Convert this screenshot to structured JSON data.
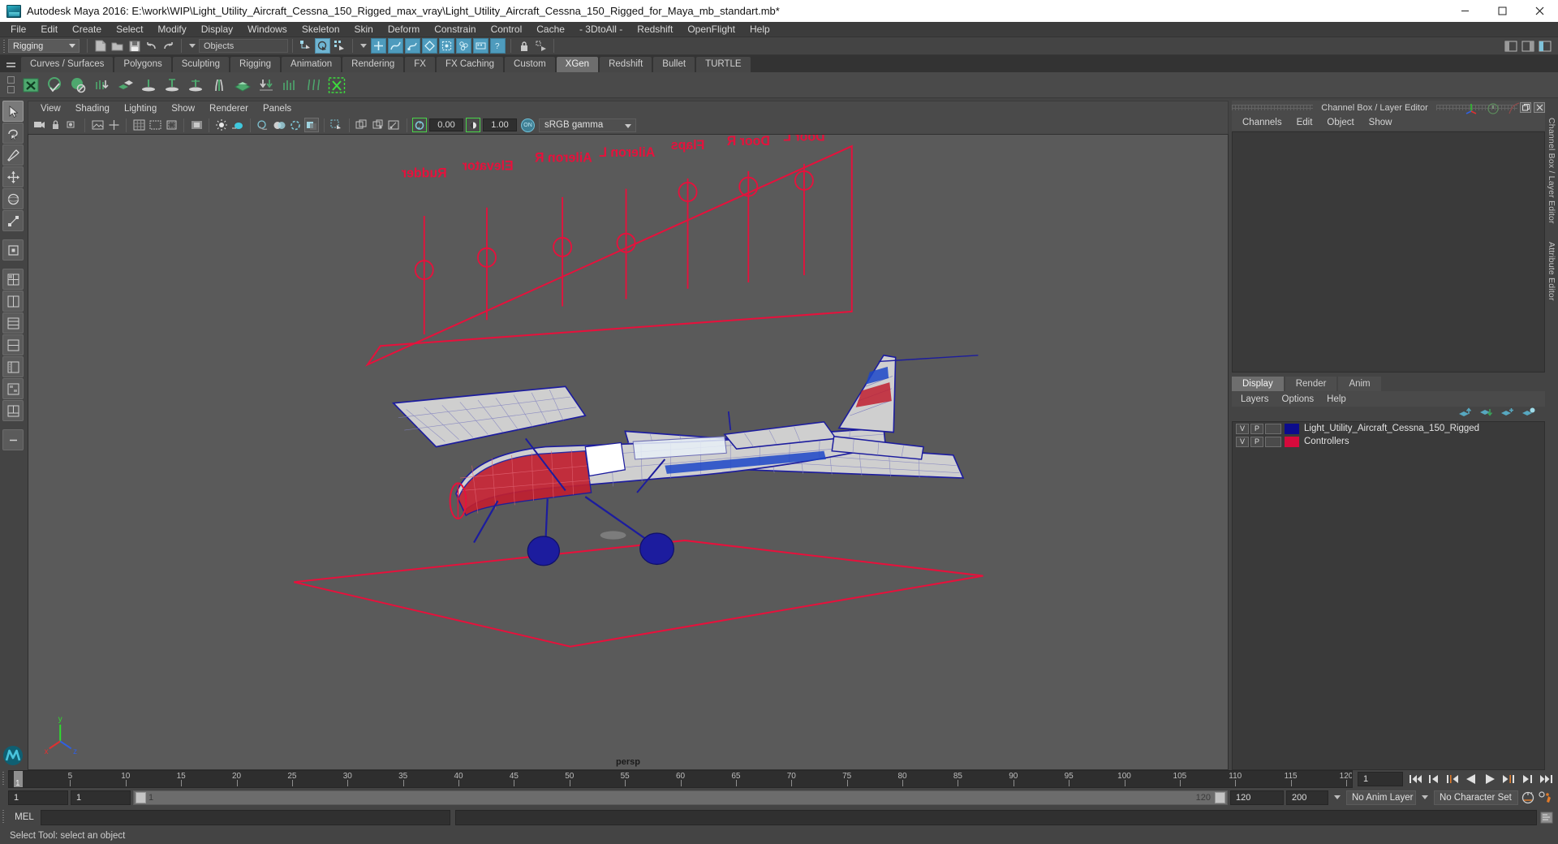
{
  "window": {
    "title": "Autodesk Maya 2016: E:\\work\\WIP\\Light_Utility_Aircraft_Cessna_150_Rigged_max_vray\\Light_Utility_Aircraft_Cessna_150_Rigged_for_Maya_mb_standart.mb*",
    "minimize": "minimize-button",
    "maximize": "maximize-button",
    "close": "close-button"
  },
  "menubar": {
    "items": [
      "File",
      "Edit",
      "Create",
      "Select",
      "Modify",
      "Display",
      "Windows",
      "Skeleton",
      "Skin",
      "Deform",
      "Constrain",
      "Control",
      "Cache",
      "- 3DtoAll -",
      "Redshift",
      "OpenFlight",
      "Help"
    ]
  },
  "statusline": {
    "menu_set": "Rigging",
    "selection_mask": "Objects"
  },
  "shelf": {
    "tabs": [
      "Curves / Surfaces",
      "Polygons",
      "Sculpting",
      "Rigging",
      "Animation",
      "Rendering",
      "FX",
      "FX Caching",
      "Custom",
      "XGen",
      "Redshift",
      "Bullet",
      "TURTLE"
    ],
    "active_tab": "XGen"
  },
  "viewport": {
    "menus": [
      "View",
      "Shading",
      "Lighting",
      "Show",
      "Renderer",
      "Panels"
    ],
    "exposure": "0.00",
    "gamma": "1.00",
    "color_management_toggle": "ON",
    "view_transform": "sRGB gamma",
    "camera_label": "persp",
    "axis": {
      "x": "x",
      "y": "y",
      "z": "z"
    },
    "controller_labels": [
      "Rudder",
      "Elevator",
      "Aileron R",
      "Aileron L",
      "Flaps",
      "Door R",
      "Door L"
    ]
  },
  "right_panel": {
    "title": "Channel Box / Layer Editor",
    "channel_menus": [
      "Channels",
      "Edit",
      "Object",
      "Show"
    ],
    "layer_tabs": [
      "Display",
      "Render",
      "Anim"
    ],
    "active_layer_tab": "Display",
    "layer_menus": [
      "Layers",
      "Options",
      "Help"
    ],
    "layers": [
      {
        "visible": "V",
        "playback": "P",
        "color": "#0c0c8c",
        "name": "Light_Utility_Aircraft_Cessna_150_Rigged"
      },
      {
        "visible": "V",
        "playback": "P",
        "color": "#d60a3c",
        "name": "Controllers"
      }
    ],
    "edge_tabs": [
      "Channel Box / Layer Editor",
      "Attribute Editor"
    ]
  },
  "timeline": {
    "labels": [
      "5",
      "10",
      "15",
      "20",
      "25",
      "30",
      "35",
      "40",
      "45",
      "50",
      "55",
      "60",
      "65",
      "70",
      "75",
      "80",
      "85",
      "90",
      "95",
      "100",
      "105",
      "110",
      "115",
      "120"
    ],
    "current_frame": "1",
    "start_display": "1",
    "range_start": "1",
    "range_min": "1",
    "range_slider_start": "1",
    "range_slider_end": "120",
    "range_end": "120",
    "anim_end": "200",
    "anim_layer": "No Anim Layer",
    "character_set": "No Character Set",
    "playback_buttons": [
      "go-to-start",
      "step-back-key",
      "step-back-frame",
      "play-backwards",
      "play-forwards",
      "step-forward-frame",
      "step-forward-key",
      "go-to-end"
    ]
  },
  "command_line": {
    "label": "MEL",
    "value": "",
    "placeholder": ""
  },
  "status_bar": {
    "message": "Select Tool: select an object"
  },
  "colors": {
    "accent_blue": "#4e9bbd",
    "shelf_green": "#4ea86e",
    "controller_red": "#e01030",
    "mesh_blue": "#1c1c9e",
    "viewport_bg": "#5a5a5a"
  }
}
